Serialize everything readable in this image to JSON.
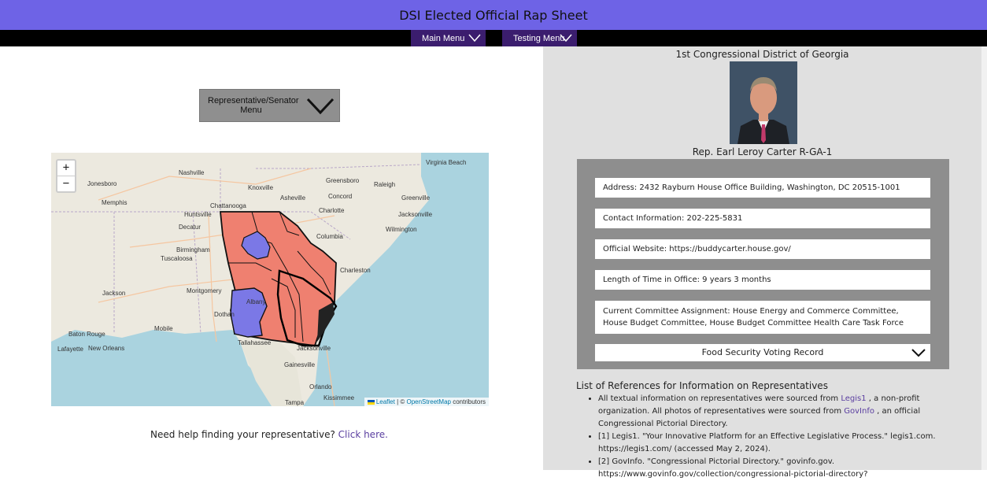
{
  "header": {
    "title": "DSI Elected Official Rap Sheet"
  },
  "nav": {
    "main_menu": "Main Menu",
    "testing_menu": "Testing Menu"
  },
  "left": {
    "rep_menu_label": "Representative/Senator Menu",
    "help_text": "Need help finding your representative?",
    "help_link": "Click here."
  },
  "map": {
    "zoom_in": "+",
    "zoom_out": "−",
    "attribution_leaflet": "Leaflet",
    "attribution_sep": " | © ",
    "attribution_osm": "OpenStreetMap",
    "attribution_contrib": " contributors",
    "labels": [
      {
        "text": "Nashville"
      },
      {
        "text": "Knoxville"
      },
      {
        "text": "Greensboro"
      },
      {
        "text": "Raleigh"
      },
      {
        "text": "Virginia Beach"
      },
      {
        "text": "Jonesboro"
      },
      {
        "text": "Memphis"
      },
      {
        "text": "Asheville"
      },
      {
        "text": "Concord"
      },
      {
        "text": "Greenville"
      },
      {
        "text": "Chattanooga"
      },
      {
        "text": "Charlotte"
      },
      {
        "text": "Jacksonville"
      },
      {
        "text": "Huntsville"
      },
      {
        "text": "Decatur"
      },
      {
        "text": "Columbia"
      },
      {
        "text": "Wilmington"
      },
      {
        "text": "Birmingham"
      },
      {
        "text": "Tuscaloosa"
      },
      {
        "text": "Charleston"
      },
      {
        "text": "Jackson"
      },
      {
        "text": "Montgomery"
      },
      {
        "text": "Mobile"
      },
      {
        "text": "Dothan"
      },
      {
        "text": "Tallahassee"
      },
      {
        "text": "Jacksonville"
      },
      {
        "text": "Baton Rouge"
      },
      {
        "text": "New Orleans"
      },
      {
        "text": "Lafayette"
      },
      {
        "text": "Gainesville"
      },
      {
        "text": "Orlando"
      },
      {
        "text": "Tampa"
      },
      {
        "text": "Kissimmee"
      },
      {
        "text": "Albany"
      }
    ]
  },
  "colors": {
    "header_bg": "#6e63e6",
    "nav_button_bg": "#3b1d6e",
    "district_red": "#ef8070",
    "district_blue": "#7b78e6",
    "link": "#5a3ea0"
  },
  "profile": {
    "district": "1st Congressional District of Georgia",
    "name": "Rep. Earl Leroy Carter R-GA-1",
    "address": "Address: 2432 Rayburn House Office Building, Washington, DC 20515-1001",
    "contact": "Contact Information: 202-225-5831",
    "website": "Official Website: https://buddycarter.house.gov/",
    "length": "Length of Time in Office: 9 years 3 months",
    "committee": "Current Committee Assignment: House Energy and Commerce Committee, House Budget Committee, House Budget Committee Health Care Task Force",
    "voting_record": "Food Security Voting Record"
  },
  "references": {
    "title": "List of References for Information on Representatives",
    "item1_a": "All textual information on representatives were sourced from ",
    "item1_link1": "Legis1",
    "item1_b": " , a non-profit organization. All photos of representatives were sourced from ",
    "item1_link2": "GovInfo",
    "item1_c": " , an official Congressional Pictorial Directory.",
    "item2": "[1] Legis1. \"Your Innovative Platform for an Effective Legislative Process.\" legis1.com. https://legis1.com/ (accessed May 2, 2024).",
    "item3": "[2] GovInfo. \"Congressional Pictorial Directory.\" govinfo.gov. https://www.govinfo.gov/collection/congressional-pictorial-directory?"
  }
}
